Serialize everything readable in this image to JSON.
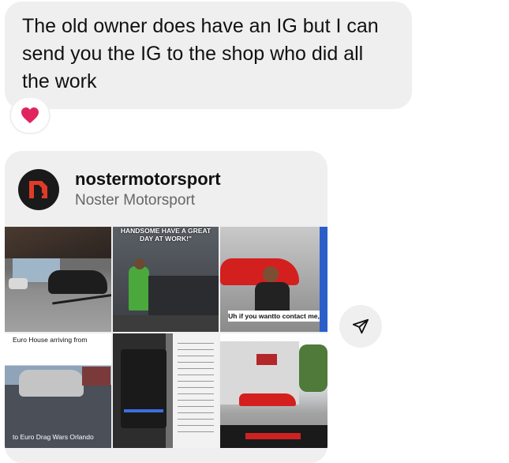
{
  "message": {
    "text": "The old owner does have an IG but I can send you the IG to the shop who did all the work",
    "reaction": "heart-emoji"
  },
  "shared_profile": {
    "username": "nostermotorsport",
    "full_name": "Noster Motorsport",
    "grid": {
      "tile2_caption": "HANDSOME HAVE A GREAT DAY AT WORK!\"",
      "tile3_caption": "Uh if you wantto contact me,",
      "tile4_caption": "Euro House arriving from",
      "tile4_footer": "to Euro Drag Wars  Orlando"
    }
  },
  "icons": {
    "send": "send-icon",
    "reaction": "heart-icon"
  },
  "colors": {
    "bubble_bg": "#efefef",
    "heart": "#e0245e"
  }
}
